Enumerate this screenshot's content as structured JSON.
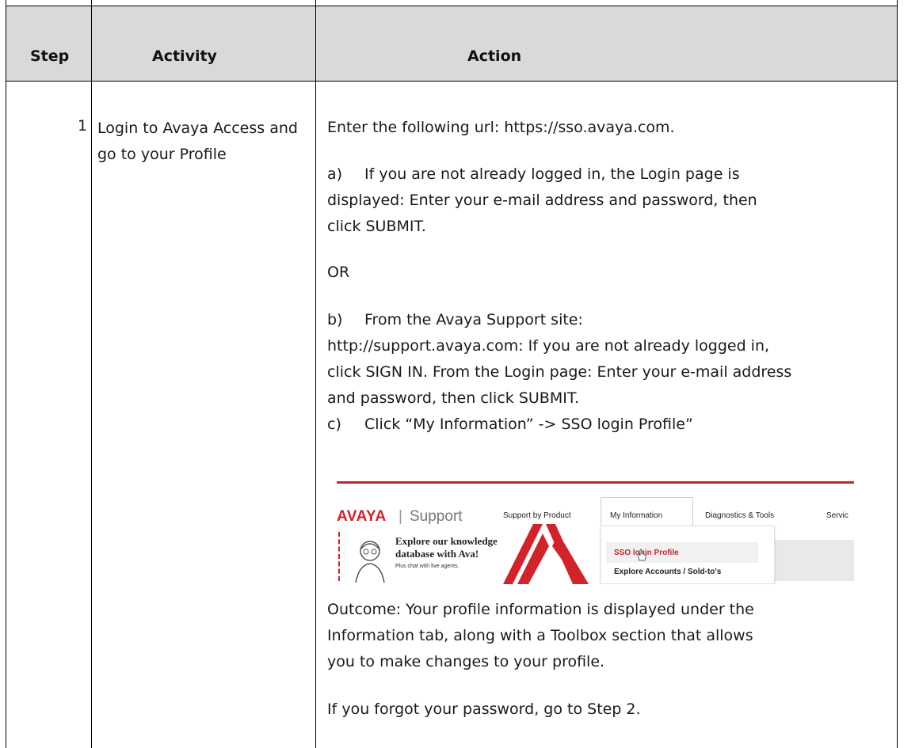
{
  "table": {
    "headers": {
      "step": "Step",
      "activity": "Activity",
      "action": "Action"
    },
    "row": {
      "step": "1",
      "activity": "Login to Avaya Access and go to your Profile",
      "action": {
        "line1": "Enter the following url: https://sso.avaya.com.",
        "a_label": "a)",
        "a_line1": "If you are not already logged in, the Login page is",
        "a_line2": "displayed: Enter your e-mail address and password, then",
        "a_line3": "click SUBMIT.",
        "or": "OR",
        "b_label": "b)",
        "b_line1": "From the Avaya Support site:",
        "b_line2": "http://support.avaya.com:   If you are not already logged in,",
        "b_line3": "click SIGN IN. From the Login page: Enter your e-mail address",
        "b_line4": "and password, then click SUBMIT.",
        "c_label": "c)",
        "c_line1": "Click “My Information” -> SSO login Profile”",
        "outcome_line1": "Outcome: Your profile information is displayed under the",
        "outcome_line2": "Information tab, along with a Toolbox section that allows",
        "outcome_line3": "you to make changes to your profile.",
        "forgot": "If you forgot your password, go to Step 2."
      }
    }
  },
  "screenshot": {
    "logo": "AVAYA",
    "logo_separator": "|",
    "logo_sub": "Support",
    "nav": [
      "Support by Product",
      "My Information",
      "Diagnostics & Tools",
      "Servic"
    ],
    "ava_title_line1": "Explore our knowledge",
    "ava_title_line2": "database with Ava!",
    "ava_sub": "Plus chat with live agents.",
    "dropdown": [
      "SSO login Profile",
      "Explore Accounts / Sold-to's"
    ],
    "accent_color": "#d2232a"
  }
}
